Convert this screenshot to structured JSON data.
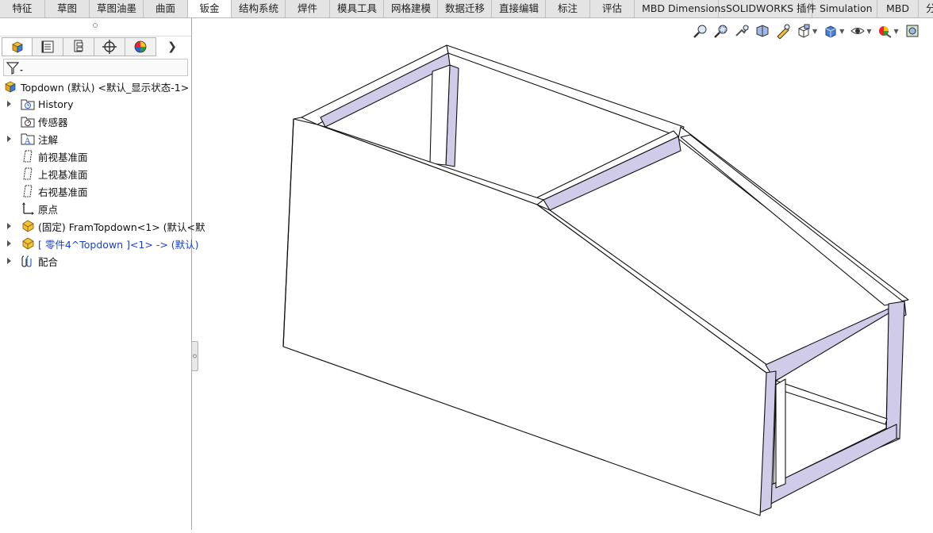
{
  "command_tabs": [
    {
      "label": "特征",
      "width": 57,
      "active": false
    },
    {
      "label": "草图",
      "width": 56,
      "active": false
    },
    {
      "label": "草图油墨",
      "width": 68,
      "active": false
    },
    {
      "label": "曲面",
      "width": 56,
      "active": false
    },
    {
      "label": "钣金",
      "width": 55,
      "active": true
    },
    {
      "label": "结构系统",
      "width": 68,
      "active": false
    },
    {
      "label": "焊件",
      "width": 56,
      "active": false
    },
    {
      "label": "模具工具",
      "width": 68,
      "active": false
    },
    {
      "label": "网格建模",
      "width": 68,
      "active": false
    },
    {
      "label": "数据迁移",
      "width": 68,
      "active": false
    },
    {
      "label": "直接编辑",
      "width": 68,
      "active": false
    },
    {
      "label": "标注",
      "width": 56,
      "active": false
    },
    {
      "label": "评估",
      "width": 56,
      "active": false
    },
    {
      "label": "MBD Dimensions",
      "width": 106,
      "active": false
    },
    {
      "label": "SOLIDWORKS 插件",
      "width": 118,
      "active": false
    },
    {
      "label": "Simulation",
      "width": 82,
      "active": false
    },
    {
      "label": "MBD",
      "width": 52,
      "active": false
    },
    {
      "label": "分析",
      "width": 40,
      "active": false
    }
  ],
  "feature_tree": {
    "root": "Topdown (默认) <默认_显示状态-1>",
    "items": [
      {
        "label": "History",
        "icon": "history-folder-icon",
        "expandable": true
      },
      {
        "label": "传感器",
        "icon": "sensor-icon",
        "expandable": false
      },
      {
        "label": "注解",
        "icon": "annotation-icon",
        "expandable": true
      },
      {
        "label": "前视基准面",
        "icon": "plane-icon",
        "expandable": false
      },
      {
        "label": "上视基准面",
        "icon": "plane-icon",
        "expandable": false
      },
      {
        "label": "右视基准面",
        "icon": "plane-icon",
        "expandable": false
      },
      {
        "label": "原点",
        "icon": "origin-icon",
        "expandable": false
      },
      {
        "label": "(固定) FramTopdown<1> (默认<默",
        "icon": "part-icon",
        "expandable": true,
        "highlight": false
      },
      {
        "label": "[ 零件4^Topdown ]<1> -> (默认)",
        "icon": "part-icon",
        "expandable": true,
        "highlight": true
      },
      {
        "label": "配合",
        "icon": "mates-icon",
        "expandable": true
      }
    ]
  },
  "colors": {
    "active_tab": "#ffffff",
    "tab_bar": "#e4e4e4",
    "frame_face": "#cfcbe8",
    "selected_text": "#1a3fd0"
  }
}
